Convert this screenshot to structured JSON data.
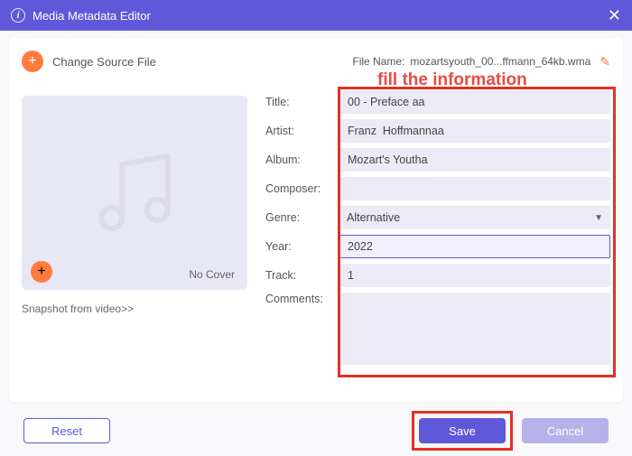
{
  "titlebar": {
    "title": "Media Metadata Editor"
  },
  "header": {
    "change_source": "Change Source File",
    "file_name_label": "File Name:",
    "file_name_value": "mozartsyouth_00...ffmann_64kb.wma"
  },
  "annotation": "fill the information",
  "cover": {
    "no_cover": "No Cover",
    "snapshot": "Snapshot from video>>"
  },
  "fields": {
    "title_label": "Title:",
    "title_value": "00 - Preface aa",
    "artist_label": "Artist:",
    "artist_value": "Franz  Hoffmannaa",
    "album_label": "Album:",
    "album_value": "Mozart's Youtha",
    "composer_label": "Composer:",
    "composer_value": "",
    "genre_label": "Genre:",
    "genre_value": "Alternative",
    "year_label": "Year:",
    "year_value": "2022",
    "track_label": "Track:",
    "track_value": "1",
    "comments_label": "Comments:",
    "comments_value": ""
  },
  "buttons": {
    "reset": "Reset",
    "save": "Save",
    "cancel": "Cancel"
  }
}
